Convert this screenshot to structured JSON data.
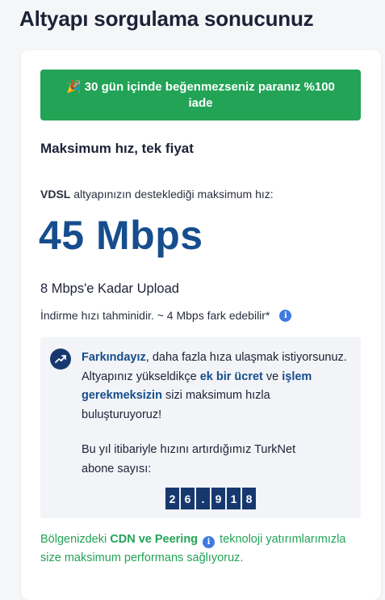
{
  "page": {
    "title": "Altyapı sorgulama sonucunuz"
  },
  "guarantee": {
    "icon": "party-popper-icon",
    "emoji": "🎉",
    "text": "30 gün içinde beğenmezseniz paranız %100 iade",
    "color": "#22a356"
  },
  "plan": {
    "subtitle": "Maksimum hız, tek fiyat",
    "infra_type": "VDSL",
    "infra_text": " altyapınızın desteklediği maksimum hız:",
    "max_speed": "45 Mbps",
    "upload": "8 Mbps'e Kadar Upload",
    "estimate": "İndirme hızı tahminidir. ~ 4 Mbps fark edebilir*",
    "estimate_info_icon": "info-icon"
  },
  "awareness": {
    "icon": "trend-up-icon",
    "p1_bold": "Farkındayız",
    "p1_a": ", daha fazla hıza ulaşmak istiyorsunuz. Altyapınız yükseldikçe ",
    "p1_bold2": "ek bir ücret",
    "p1_b": " ve ",
    "p1_bold3": "işlem gerekmeksizin",
    "p1_c": " sizi maksimum hızla buluşturuyoruz!",
    "count_label": "Bu yıl itibariyle hızını artırdığımız TurkNet abone sayısı:",
    "count_digits": [
      "2",
      "6",
      ".",
      "9",
      "1",
      "8"
    ]
  },
  "cdn": {
    "prefix": "Bölgenizdeki ",
    "bold": "CDN ve Peering",
    "suffix": " teknoloji yatırımlarımızla size maksimum performans sağlıyoruz.",
    "info_icon": "info-icon",
    "color": "#22a356"
  },
  "colors": {
    "brand_navy": "#164d8d",
    "dark_navy": "#17386f",
    "green": "#22a356",
    "info_blue": "#3d7be0"
  }
}
